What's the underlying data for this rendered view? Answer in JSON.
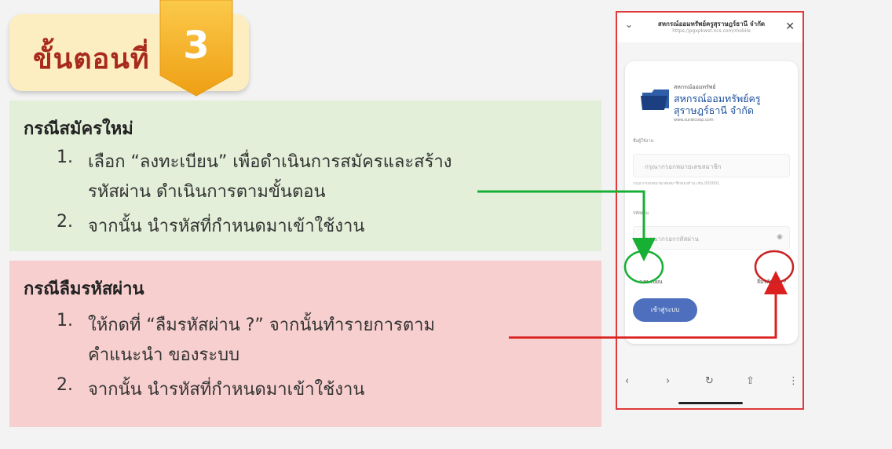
{
  "step": {
    "title": "ขั้นตอนที่",
    "number": "3"
  },
  "new_member": {
    "title": "กรณีสมัครใหม่",
    "item1_num": "1.",
    "item1_line1": "เลือก “ลงทะเบียน” เพื่อดำเนินการสมัครและสร้าง",
    "item1_line2": "รหัสผ่าน ดำเนินการตามขั้นตอน",
    "item2_num": "2.",
    "item2_text": "จากนั้น นำรหัสที่กำหนดมาเข้าใช้งาน"
  },
  "forgot_password": {
    "title": "กรณีลืมรหัสผ่าน",
    "item1_num": "1.",
    "item1_line1": "ให้กดที่ “ลืมรหัสผ่าน ?” จากนั้นทำรายการตาม",
    "item1_line2": "คำแนะนำ      ของระบบ",
    "item2_num": "2.",
    "item2_text": "จากนั้น นำรหัสที่กำหนดมาเข้าใช้งาน"
  },
  "phone": {
    "title": "สหกรณ์ออมทรัพย์ครูสุราษฎร์ธานี จำกัด",
    "subtitle": "https://pgxpkwst.ncs.com/mobile",
    "logo_small": "สหกรณ์ออมทรัพย์",
    "logo_line1": "สหกรณ์ออมทรัพย์ครู",
    "logo_line2": "สุราษฎร์ธานี จำกัด",
    "logo_url": "www.suratcoop.com",
    "username_label": "ชื่อผู้ใช้งาน",
    "username_placeholder": "กรุณากรอกหมายเลขสมาชิก",
    "username_hint": "กรุณากรอกหมายเลขสมาชิกของท่าน เช่น 000001",
    "password_label": "รหัสผ่าน",
    "password_placeholder": "กรุณากรอกรหัสผ่าน",
    "register_link": "ลงทะเบียน",
    "forgot_link": "ลืมรหัสผ่าน ?",
    "login_button": "เข้าสู่ระบบ",
    "close_icon": "close-icon",
    "chevron_icon": "chevron-down-icon"
  },
  "colors": {
    "green_panel": "#e3efd9",
    "red_panel": "#f8cfcf",
    "accent_orange": "#f5b52c",
    "title_red": "#a82a1c",
    "green_arrow": "#17b035",
    "red_arrow": "#dc1f1f",
    "login_blue": "#4d6fbd"
  }
}
